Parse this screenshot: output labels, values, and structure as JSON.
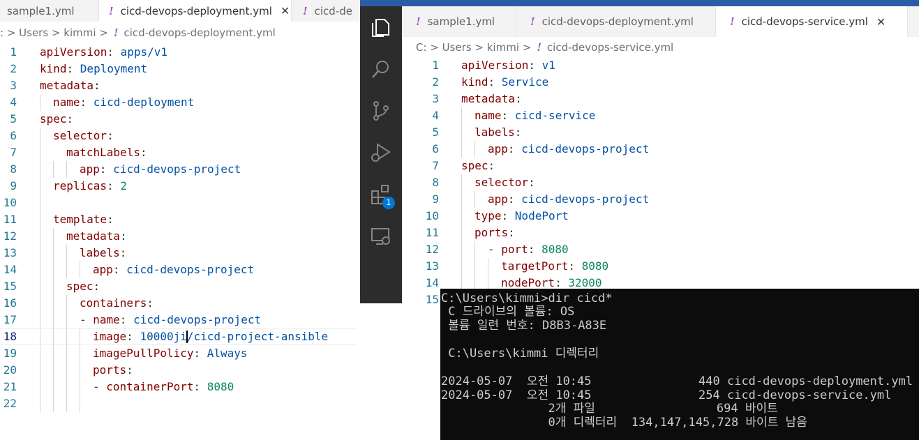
{
  "left_editor": {
    "tabs": [
      {
        "label": "sample1.yml",
        "active": false
      },
      {
        "label": "cicd-devops-deployment.yml",
        "active": true
      },
      {
        "label": "cicd-de",
        "active": false
      }
    ],
    "breadcrumb": {
      "prefix": ": > Users > kimmi >",
      "file": "cicd-devops-deployment.yml"
    },
    "lines": [
      {
        "n": "1"
      },
      {
        "n": "2"
      },
      {
        "n": "3"
      },
      {
        "n": "4"
      },
      {
        "n": "5"
      },
      {
        "n": "6"
      },
      {
        "n": "7"
      },
      {
        "n": "8"
      },
      {
        "n": "9"
      },
      {
        "n": "10"
      },
      {
        "n": "11"
      },
      {
        "n": "12"
      },
      {
        "n": "13"
      },
      {
        "n": "14"
      },
      {
        "n": "15"
      },
      {
        "n": "16"
      },
      {
        "n": "17"
      },
      {
        "n": "18"
      },
      {
        "n": "19"
      },
      {
        "n": "20"
      },
      {
        "n": "21"
      },
      {
        "n": "22"
      }
    ],
    "code": {
      "l1k": "apiVersion",
      "l1v": "apps/v1",
      "l2k": "kind",
      "l2v": "Deployment",
      "l3k": "metadata",
      "l4k": "name",
      "l4v": "cicd-deployment",
      "l5k": "spec",
      "l6k": "selector",
      "l7k": "matchLabels",
      "l8k": "app",
      "l8v": "cicd-devops-project",
      "l9k": "replicas",
      "l9v": "2",
      "l11k": "template",
      "l12k": "metadata",
      "l13k": "labels",
      "l14k": "app",
      "l14v": "cicd-devops-project",
      "l15k": "spec",
      "l16k": "containers",
      "l17k": "name",
      "l17v": "cicd-devops-project",
      "l18k": "image",
      "l18v": "10000ji/cicd-project-ansible",
      "l19k": "imagePullPolicy",
      "l19v": "Always",
      "l20k": "ports",
      "l21k": "containerPort",
      "l21v": "8080"
    }
  },
  "right_editor": {
    "tabs": [
      {
        "label": "sample1.yml",
        "active": false
      },
      {
        "label": "cicd-devops-deployment.yml",
        "active": false
      },
      {
        "label": "cicd-devops-service.yml",
        "active": true
      }
    ],
    "breadcrumb": {
      "prefix": "C: > Users > kimmi >",
      "file": "cicd-devops-service.yml"
    },
    "lines": [
      {
        "n": "1"
      },
      {
        "n": "2"
      },
      {
        "n": "3"
      },
      {
        "n": "4"
      },
      {
        "n": "5"
      },
      {
        "n": "6"
      },
      {
        "n": "7"
      },
      {
        "n": "8"
      },
      {
        "n": "9"
      },
      {
        "n": "10"
      },
      {
        "n": "11"
      },
      {
        "n": "12"
      },
      {
        "n": "13"
      },
      {
        "n": "14"
      },
      {
        "n": "15"
      }
    ],
    "code": {
      "l1k": "apiVersion",
      "l1v": "v1",
      "l2k": "kind",
      "l2v": "Service",
      "l3k": "metadata",
      "l4k": "name",
      "l4v": "cicd-service",
      "l5k": "labels",
      "l6k": "app",
      "l6v": "cicd-devops-project",
      "l7k": "spec",
      "l8k": "selector",
      "l9k": "app",
      "l9v": "cicd-devops-project",
      "l10k": "type",
      "l10v": "NodePort",
      "l11k": "ports",
      "l12k": "port",
      "l12v": "8080",
      "l13k": "targetPort",
      "l13v": "8080",
      "l14k": "nodePort",
      "l14v": "32000"
    },
    "activity_bar": {
      "icons": [
        "explorer-icon",
        "search-icon",
        "source-control-icon",
        "run-debug-icon",
        "extensions-icon",
        "remote-explorer-icon"
      ],
      "extensions_badge": "1"
    }
  },
  "terminal": {
    "lines": [
      "C:\\Users\\kimmi>dir cicd*",
      " C 드라이브의 볼륨: OS",
      " 볼륨 일련 번호: D8B3-A83E",
      "",
      " C:\\Users\\kimmi 디렉터리",
      "",
      "2024-05-07  오전 10:45               440 cicd-devops-deployment.yml",
      "2024-05-07  오전 10:45               254 cicd-devops-service.yml",
      "               2개 파일                 694 바이트",
      "               0개 디렉터리  134,147,145,728 바이트 남음"
    ]
  },
  "colors": {
    "key": "#800000",
    "string": "#0451a5",
    "number": "#098658",
    "line_number": "#237893",
    "activity_bar": "#2c2c2c",
    "terminal_bg": "#0c0c0c",
    "terminal_fg": "#cccccc",
    "yaml_icon": "#9b4fbd"
  }
}
